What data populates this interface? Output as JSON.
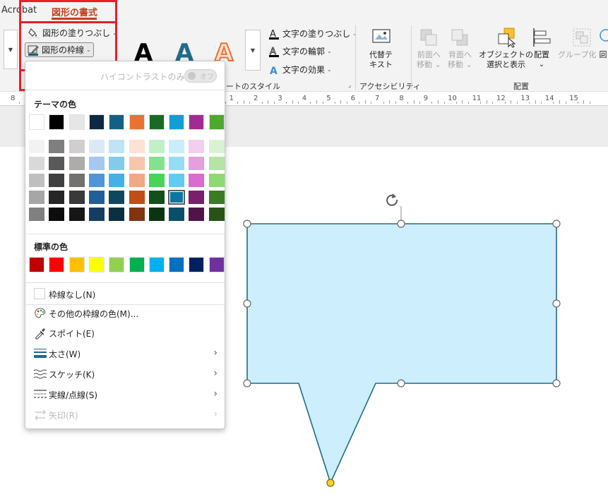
{
  "tabs": {
    "acrobat": "Acrobat",
    "shape_format": "図形の書式"
  },
  "ribbon": {
    "shape_fill": "図形の塗りつぶし",
    "shape_outline": "図形の枠線",
    "wordart_label_partial": "ートのスタイル",
    "text_fill": "文字の塗りつぶし",
    "text_outline": "文字の輪郭",
    "text_effects": "文字の効果",
    "alt_text_line1": "代替テ",
    "alt_text_line2": "キスト",
    "accessibility_label": "アクセシビリティ",
    "bring_forward_line1": "前面へ",
    "bring_forward_line2": "移動",
    "send_backward_line1": "背面へ",
    "send_backward_line2": "移動",
    "selection_pane_line1": "オブジェクトの",
    "selection_pane_line2": "選択と表示",
    "align": "配置",
    "group": "グループ化",
    "rotate_partial": "回",
    "arrange_label": "配置",
    "wordart_letter": "A"
  },
  "ruler": {
    "numbers": [
      "8",
      "7",
      "6",
      "5",
      "4",
      "3",
      "2",
      "1",
      "0",
      "1",
      "2",
      "3",
      "4",
      "5",
      "6",
      "7",
      "8",
      "9",
      "10",
      "11",
      "12",
      "13",
      "14",
      "15"
    ]
  },
  "dropdown": {
    "high_contrast_label": "ハイコントラストのみ(H)",
    "toggle_off": "オフ",
    "theme_colors_label": "テーマの色",
    "standard_colors_label": "標準の色",
    "no_outline": "枠線なし(N)",
    "more_colors": "その他の枠線の色(M)...",
    "eyedropper": "スポイト(E)",
    "weight": "太さ(W)",
    "sketch": "スケッチ(K)",
    "dashes": "実線/点線(S)",
    "arrows": "矢印(R)"
  },
  "colors": {
    "accent": "#c43e1c",
    "highlight": "#e8202a",
    "shape_fill": "#cdeefc",
    "shape_stroke": "#1e6b8c",
    "theme_base": [
      "#ffffff",
      "#000000",
      "#e7e6e6",
      "#0e2841",
      "#156082",
      "#e97132",
      "#196b24",
      "#0f9ed5",
      "#a02b93",
      "#4ea72e"
    ],
    "theme_tints": [
      [
        "#f2f2f2",
        "#d9d9d9",
        "#bfbfbf",
        "#a6a6a6",
        "#808080"
      ],
      [
        "#7f7f7f",
        "#595959",
        "#404040",
        "#262626",
        "#0d0d0d"
      ],
      [
        "#d0cece",
        "#aeabab",
        "#757070",
        "#3a3838",
        "#171616"
      ],
      [
        "#dae9f8",
        "#a5c8f0",
        "#4e95d9",
        "#215f9a",
        "#153d64"
      ],
      [
        "#c0e4f5",
        "#83cbeb",
        "#45b0e1",
        "#0f4761",
        "#0a2f40"
      ],
      [
        "#fbe2d5",
        "#f7c7ac",
        "#f1a983",
        "#c04f15",
        "#7f3510"
      ],
      [
        "#c1f0c8",
        "#83e28e",
        "#47d459",
        "#124f1a",
        "#0b3512"
      ],
      [
        "#caedfb",
        "#95dcf7",
        "#61cbf3",
        "#0b769f",
        "#074f6a"
      ],
      [
        "#f2cfee",
        "#e59ede",
        "#d86dcd",
        "#782069",
        "#501546"
      ],
      [
        "#d9f2d0",
        "#b4e5a2",
        "#8ed973",
        "#3a7c22",
        "#275317"
      ]
    ],
    "selected_tint": [
      7,
      3
    ],
    "standard": [
      "#c00000",
      "#ff0000",
      "#ffc000",
      "#ffff00",
      "#92d050",
      "#00b050",
      "#00b0f0",
      "#0070c0",
      "#002060",
      "#7030a0"
    ]
  }
}
